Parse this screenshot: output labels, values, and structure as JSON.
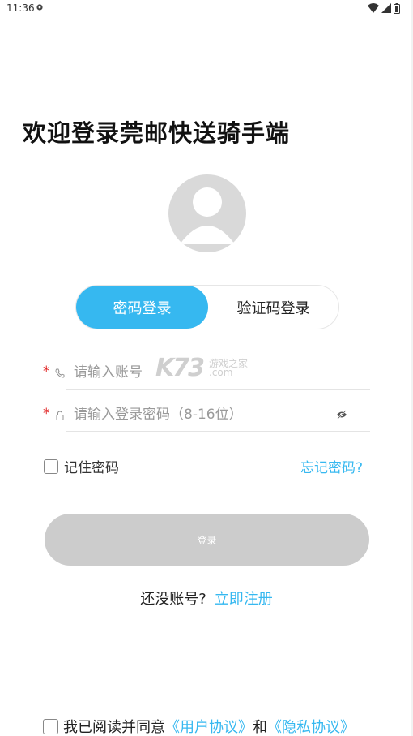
{
  "status_bar": {
    "time": "11:36"
  },
  "title": "欢迎登录莞邮快送骑手端",
  "tabs": {
    "password_login": "密码登录",
    "code_login": "验证码登录"
  },
  "form": {
    "account_placeholder": "请输入账号",
    "password_placeholder": "请输入登录密码（8-16位）",
    "required_mark": "*"
  },
  "watermark": {
    "brand": "K73",
    "sub1": "游戏之家",
    "sub2": ".com"
  },
  "remember": {
    "label": "记住密码"
  },
  "forgot_label": "忘记密码?",
  "login_button": "登录",
  "register": {
    "question": "还没账号?",
    "link": "立即注册"
  },
  "agreement": {
    "prefix": "我已阅读并同意",
    "user_agreement": "《用户协议》",
    "and": "和",
    "privacy_policy": "《隐私协议》"
  },
  "colors": {
    "accent": "#36b8f0",
    "required": "#e02020",
    "disabled_button": "#cccccc"
  }
}
